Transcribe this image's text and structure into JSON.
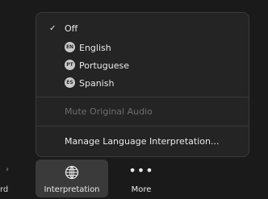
{
  "menu": {
    "off_label": "Off",
    "languages": [
      {
        "badge": "EN",
        "label": "English"
      },
      {
        "badge": "PT",
        "label": "Portuguese"
      },
      {
        "badge": "ES",
        "label": "Spanish"
      }
    ],
    "mute_original_label": "Mute Original Audio",
    "manage_label": "Manage Language Interpretation..."
  },
  "toolbar": {
    "left_partial_label": "rd",
    "interpretation_label": "Interpretation",
    "more_label": "More"
  },
  "icons": {
    "check": "check-icon",
    "interpretation": "globe-icon",
    "more": "ellipsis-icon"
  }
}
